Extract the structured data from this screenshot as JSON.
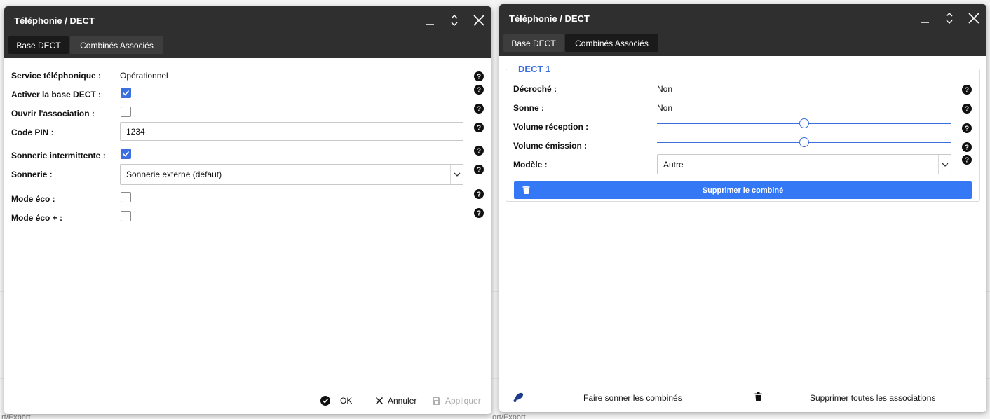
{
  "background": {
    "fragment_left": "rt/Export",
    "fragment_right": "ort/Export"
  },
  "left_window": {
    "title": "Téléphonie / DECT",
    "tabs": [
      {
        "label": "Base DECT",
        "active": true
      },
      {
        "label": "Combinés Associés",
        "active": false
      }
    ],
    "fields": {
      "service": {
        "label": "Service téléphonique :",
        "value": "Opérationnel"
      },
      "activer": {
        "label": "Activer la base DECT :",
        "checked": true
      },
      "ouvrir": {
        "label": "Ouvrir l'association :",
        "checked": false
      },
      "pin": {
        "label": "Code PIN :",
        "value": "1234"
      },
      "sonnerie_int": {
        "label": "Sonnerie intermittente :",
        "checked": true
      },
      "sonnerie": {
        "label": "Sonnerie :",
        "value": "Sonnerie externe (défaut)"
      },
      "mode_eco": {
        "label": "Mode éco :",
        "checked": false
      },
      "mode_eco_plus": {
        "label": "Mode éco + :",
        "checked": false
      }
    },
    "footer": {
      "ok_label": "OK",
      "annuler_label": "Annuler",
      "appliquer_label": "Appliquer"
    }
  },
  "right_window": {
    "title": "Téléphonie / DECT",
    "tabs": [
      {
        "label": "Base DECT",
        "active": false
      },
      {
        "label": "Combinés Associés",
        "active": true
      }
    ],
    "group": {
      "legend": "DECT 1",
      "decroche": {
        "label": "Décroché :",
        "value": "Non"
      },
      "sonne": {
        "label": "Sonne :",
        "value": "Non"
      },
      "volume_reception": {
        "label": "Volume réception :",
        "level": 0.5
      },
      "volume_emission": {
        "label": "Volume émission :",
        "level": 0.5
      },
      "modele": {
        "label": "Modèle :",
        "value": "Autre"
      },
      "delete_label": "Supprimer le combiné"
    },
    "footer": {
      "ring_label": "Faire sonner les combinés",
      "delete_all_label": "Supprimer toutes les associations"
    }
  },
  "colors": {
    "titlebar": "#2f2f2f",
    "accent": "#3b6fe0",
    "delete_button": "#3478f6"
  },
  "icons": [
    "minimize-icon",
    "maximize-icon",
    "close-icon",
    "help-icon",
    "check-circle-icon",
    "cancel-x-icon",
    "save-icon",
    "bell-icon",
    "trash-icon",
    "chevron-down-icon"
  ]
}
